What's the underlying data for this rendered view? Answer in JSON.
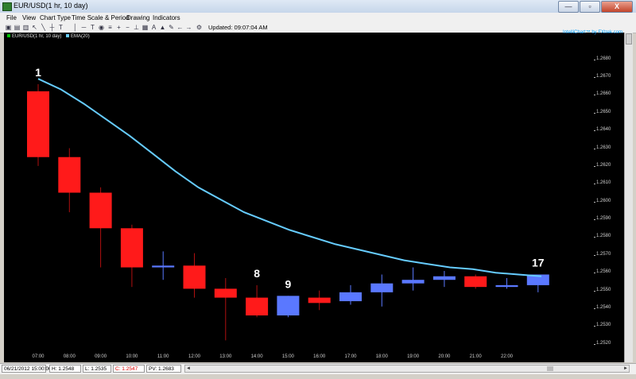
{
  "window": {
    "title": "EUR/USD(1 hr, 10 day)",
    "buttons": [
      "—",
      "▫",
      "X"
    ]
  },
  "menu": [
    "File",
    "View",
    "Chart Type",
    "Time Scale & Period",
    "Drawing",
    "Indicators"
  ],
  "toolbar": {
    "icons": [
      "print-icon",
      "save-icon",
      "open-icon",
      "pointer-icon",
      "line-icon",
      "crosshair-icon",
      "text-icon",
      "vertical-line-icon",
      "horizontal-line-icon",
      "rectangle-icon",
      "circle-icon",
      "fibonacci-icon",
      "zoom-in-icon",
      "zoom-out-icon",
      "refresh-icon",
      "save-chart-icon",
      "text-tool-icon",
      "draw-icon",
      "scroll-left-icon",
      "scroll-right-icon",
      "tools-icon"
    ],
    "updated": "Updated: 09:07:04 AM"
  },
  "legend": [
    {
      "label": "EUR/USD(1 hr, 10 day)",
      "color": "#00c000"
    },
    {
      "label": "EMA(20)",
      "color": "#66ccff"
    }
  ],
  "brand": "IntelliChart™ by FXtrek.com",
  "chart_data": {
    "type": "candlestick",
    "title": "EUR/USD(1 hr, 10 day)",
    "ylim": [
      1.2515,
      1.2695
    ],
    "y_ticks": [
      "1.2680",
      "1.2670",
      "1.2660",
      "1.2650",
      "1.2640",
      "1.2630",
      "1.2620",
      "1.2610",
      "1.2600",
      "1.2590",
      "1.2580",
      "1.2570",
      "1.2560",
      "1.2550",
      "1.2540",
      "1.2530",
      "1.2520"
    ],
    "x_ticks": [
      "07:00",
      "08:00",
      "09:00",
      "10:00",
      "11:00",
      "12:00",
      "13:00",
      "14:00",
      "15:00",
      "16:00",
      "17:00",
      "18:00",
      "19:00",
      "20:00",
      "21:00",
      "22:00"
    ],
    "colors": {
      "up": "#5a78ff",
      "down": "#ff1a1a",
      "ema": "#66ccff",
      "wick_down": "#b01010",
      "wick_up": "#5a78ff"
    },
    "candles": [
      {
        "o": 1.2662,
        "h": 1.2666,
        "l": 1.262,
        "c": 1.2625
      },
      {
        "o": 1.2625,
        "h": 1.263,
        "l": 1.2594,
        "c": 1.2605
      },
      {
        "o": 1.2605,
        "h": 1.2608,
        "l": 1.2563,
        "c": 1.2585
      },
      {
        "o": 1.2585,
        "h": 1.2587,
        "l": 1.2552,
        "c": 1.2563
      },
      {
        "o": 1.2563,
        "h": 1.2572,
        "l": 1.2556,
        "c": 1.2564
      },
      {
        "o": 1.2564,
        "h": 1.2571,
        "l": 1.2546,
        "c": 1.2551
      },
      {
        "o": 1.2551,
        "h": 1.2557,
        "l": 1.2522,
        "c": 1.2546
      },
      {
        "o": 1.2546,
        "h": 1.2553,
        "l": 1.2535,
        "c": 1.2536
      },
      {
        "o": 1.2536,
        "h": 1.2547,
        "l": 1.2535,
        "c": 1.2547
      },
      {
        "o": 1.2546,
        "h": 1.255,
        "l": 1.2539,
        "c": 1.2543
      },
      {
        "o": 1.2544,
        "h": 1.2553,
        "l": 1.2542,
        "c": 1.2549
      },
      {
        "o": 1.2549,
        "h": 1.2559,
        "l": 1.2541,
        "c": 1.2554
      },
      {
        "o": 1.2554,
        "h": 1.2563,
        "l": 1.255,
        "c": 1.2556
      },
      {
        "o": 1.2556,
        "h": 1.2561,
        "l": 1.2552,
        "c": 1.2558
      },
      {
        "o": 1.2558,
        "h": 1.2559,
        "l": 1.2551,
        "c": 1.2552
      },
      {
        "o": 1.2552,
        "h": 1.2557,
        "l": 1.2551,
        "c": 1.2553
      },
      {
        "o": 1.2553,
        "h": 1.2559,
        "l": 1.2549,
        "c": 1.2559
      }
    ],
    "ema": [
      1.2669,
      1.2663,
      1.2655,
      1.2646,
      1.2637,
      1.2627,
      1.2617,
      1.2608,
      1.2601,
      1.2594,
      1.2589,
      1.2584,
      1.258,
      1.2576,
      1.2573,
      1.257,
      1.2567,
      1.2565,
      1.2563,
      1.2562,
      1.256,
      1.2559,
      1.2558
    ],
    "annotations": [
      {
        "label": "1",
        "candle": 0
      },
      {
        "label": "8",
        "candle": 7
      },
      {
        "label": "9",
        "candle": 8
      },
      {
        "label": "17",
        "candle": 16
      }
    ]
  },
  "status": {
    "date": "06/21/2012 15:00:00",
    "high": "H: 1.2548",
    "low": "L: 1.2535",
    "close": "C: 1.2547",
    "pv": "PV: 1.2683"
  }
}
